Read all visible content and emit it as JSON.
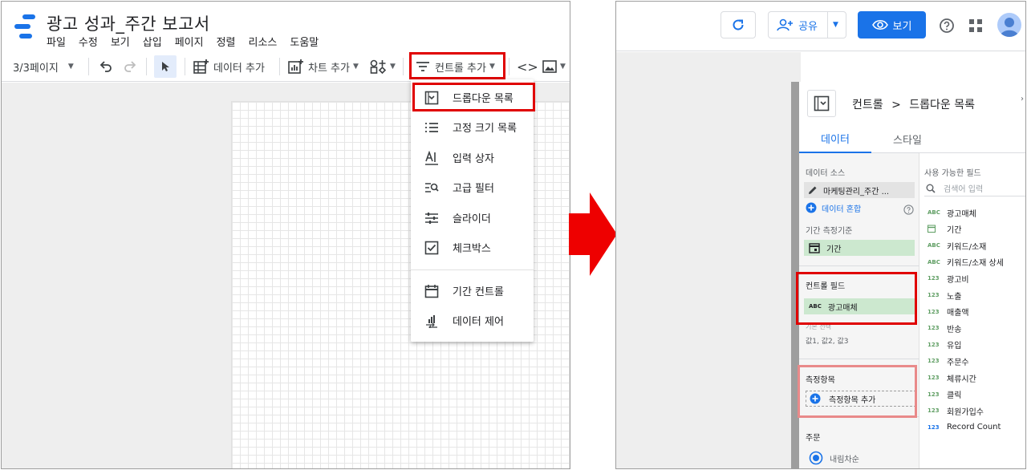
{
  "left_screen": {
    "doc_title": "광고 성과_주간 보고서",
    "menu": [
      "파일",
      "수정",
      "보기",
      "삽입",
      "페이지",
      "정렬",
      "리소스",
      "도움말"
    ],
    "toolbar": {
      "page_indicator": "3/3페이지",
      "add_data": "데이터 추가",
      "add_chart": "차트 추가",
      "add_control": "컨트롤 추가"
    },
    "control_menu": [
      {
        "label": "드롭다운 목록",
        "icon": "dropdown-list-icon"
      },
      {
        "label": "고정 크기 목록",
        "icon": "fixed-list-icon"
      },
      {
        "label": "입력 상자",
        "icon": "input-box-icon"
      },
      {
        "label": "고급 필터",
        "icon": "advanced-filter-icon"
      },
      {
        "label": "슬라이더",
        "icon": "slider-icon"
      },
      {
        "label": "체크박스",
        "icon": "checkbox-icon"
      },
      {
        "label": "기간 컨트롤",
        "icon": "calendar-icon"
      },
      {
        "label": "데이터 제어",
        "icon": "data-control-icon"
      }
    ]
  },
  "right_screen": {
    "topbar": {
      "share": "공유",
      "view": "보기"
    },
    "panel": {
      "breadcrumb_root": "컨트롤",
      "breadcrumb_sep": ">",
      "breadcrumb_leaf": "드롭다운 목록",
      "tabs": [
        "데이터",
        "스타일"
      ],
      "data_source_label": "데이터 소스",
      "data_source_value": "마케팅관리_주간 ...",
      "blend_data": "데이터 혼합",
      "date_range_label": "기간 측정기준",
      "date_range_value": "기간",
      "control_field_label": "컨트롤 필드",
      "control_field_value": "광고매체",
      "control_field_type": "ABC",
      "default_label": "기본 선택",
      "default_value": "값1, 값2, 값3",
      "metric_label": "측정항목",
      "add_metric": "측정항목 추가",
      "sort_label": "주문",
      "sort_value": "내림차순",
      "available_fields_label": "사용 가능한 필드",
      "search_placeholder": "검색어 입력",
      "fields": [
        {
          "type": "ABC",
          "name": "광고매체"
        },
        {
          "type": "date",
          "name": "기간"
        },
        {
          "type": "ABC",
          "name": "키워드/소재"
        },
        {
          "type": "ABC",
          "name": "키워드/소재 상세"
        },
        {
          "type": "123",
          "name": "광고비"
        },
        {
          "type": "123",
          "name": "노출"
        },
        {
          "type": "123",
          "name": "매출액"
        },
        {
          "type": "123",
          "name": "반송"
        },
        {
          "type": "123",
          "name": "유입"
        },
        {
          "type": "123",
          "name": "주문수"
        },
        {
          "type": "123",
          "name": "체류시간"
        },
        {
          "type": "123",
          "name": "클릭"
        },
        {
          "type": "123",
          "name": "회원가입수"
        },
        {
          "type": "123",
          "name": "Record Count"
        }
      ]
    }
  },
  "colors": {
    "highlight": "#e00000",
    "accent": "#1a73e8",
    "chip_green": "#cce8cf",
    "arrow": "#ee0000"
  }
}
